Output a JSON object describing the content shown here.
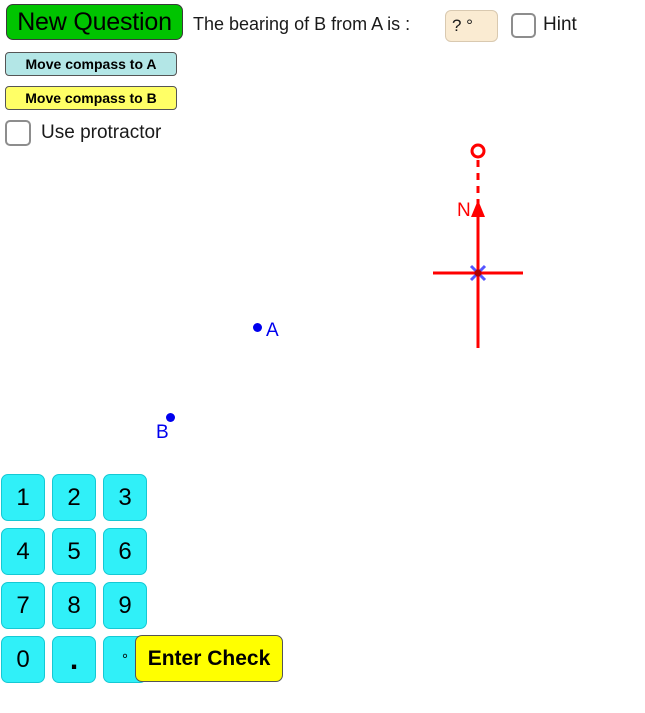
{
  "toolbar": {
    "new_question_label": "New Question",
    "prompt_text": "The bearing of B from A is :",
    "answer_value": "? °",
    "answer_placeholder": "? °",
    "hint_label": "Hint",
    "move_compass_to_a_label": "Move compass to A",
    "move_compass_to_b_label": "Move compass to B",
    "use_protractor_label": "Use protractor"
  },
  "diagram": {
    "point_a_label": "A",
    "point_b_label": "B",
    "north_label": "N",
    "point_color": "#0000ee",
    "compass_color": "#ff0000",
    "center_marker_color": "#5555ff"
  },
  "keypad": {
    "keys": [
      {
        "label": "1",
        "name": "key-1"
      },
      {
        "label": "2",
        "name": "key-2"
      },
      {
        "label": "3",
        "name": "key-3"
      },
      {
        "label": "4",
        "name": "key-4"
      },
      {
        "label": "5",
        "name": "key-5"
      },
      {
        "label": "6",
        "name": "key-6"
      },
      {
        "label": "7",
        "name": "key-7"
      },
      {
        "label": "8",
        "name": "key-8"
      },
      {
        "label": "9",
        "name": "key-9"
      },
      {
        "label": "0",
        "name": "key-0"
      },
      {
        "label": ".",
        "name": "key-decimal"
      },
      {
        "label": "°",
        "name": "key-degree"
      }
    ],
    "enter_check_label": "Enter Check"
  },
  "colors": {
    "new_question_bg": "#00c400",
    "move_a_bg": "#b3e6e6",
    "move_b_bg": "#ffff66",
    "key_bg": "#30f0f8",
    "enter_check_bg": "#ffff00",
    "answer_field_bg": "#faebd2"
  }
}
